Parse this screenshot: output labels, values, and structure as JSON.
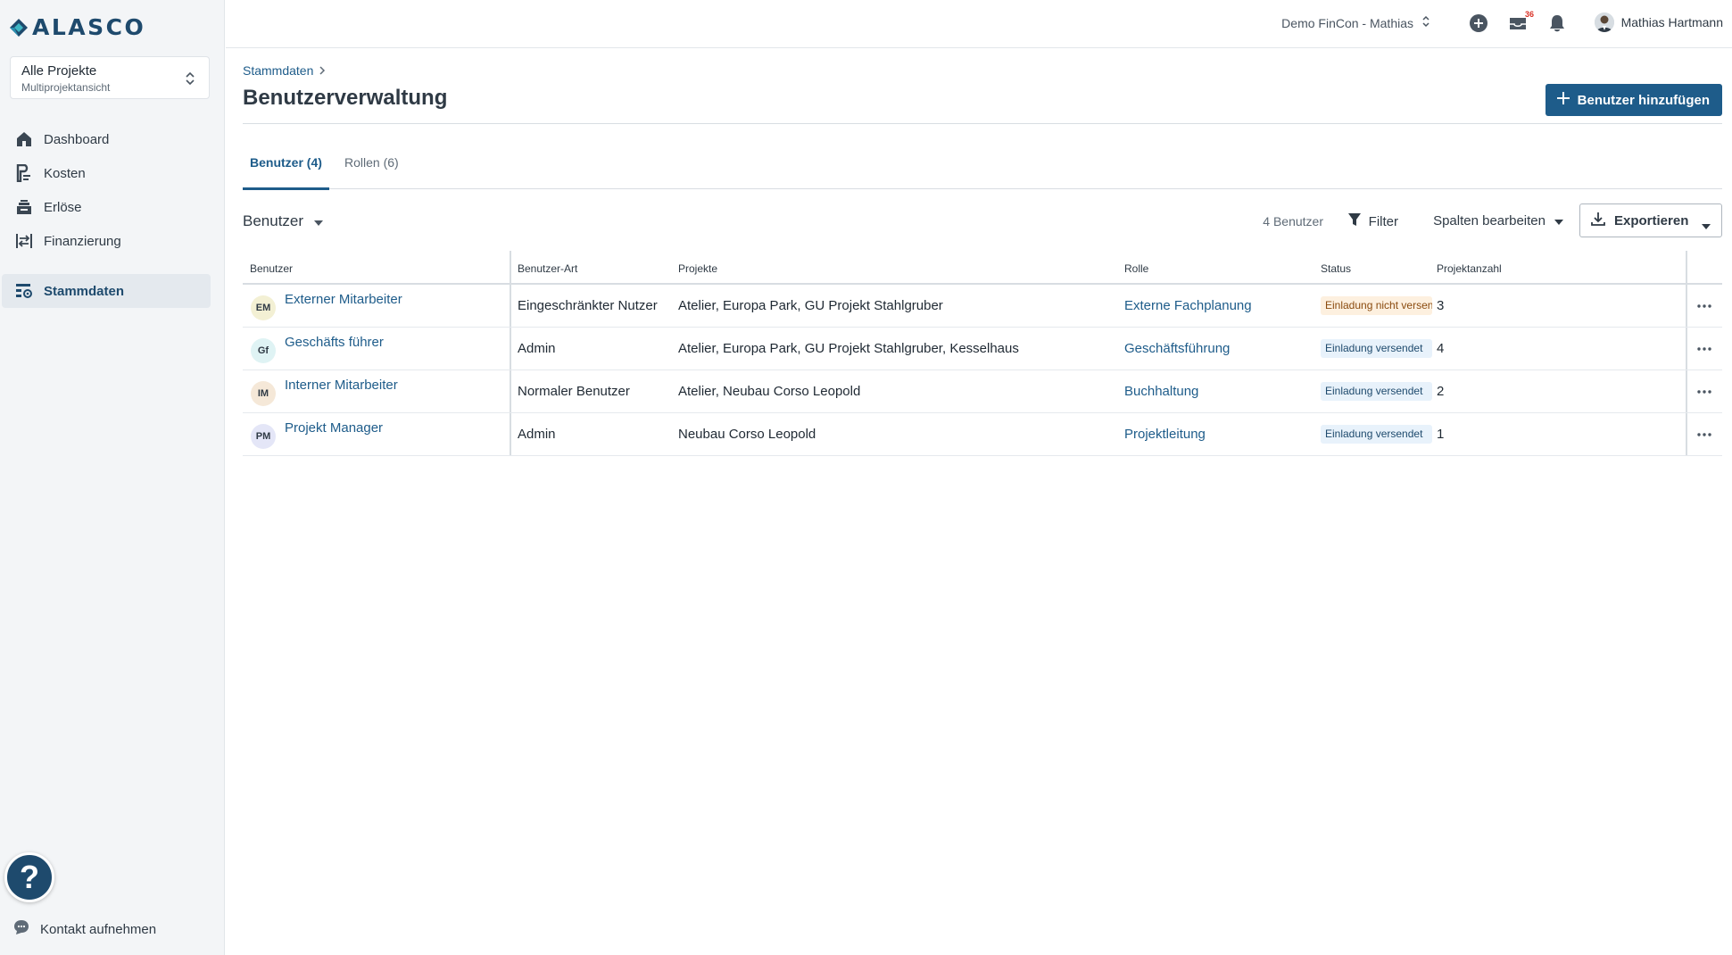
{
  "app": {
    "logo_text": "ALASCO",
    "project_selector": {
      "title": "Alle Projekte",
      "subtitle": "Multiprojektansicht"
    },
    "nav": [
      {
        "label": "Dashboard",
        "icon": "home-icon"
      },
      {
        "label": "Kosten",
        "icon": "costs-icon"
      },
      {
        "label": "Erlöse",
        "icon": "revenue-icon"
      },
      {
        "label": "Finanzierung",
        "icon": "financing-icon"
      },
      {
        "label": "Stammdaten",
        "icon": "master-data-icon",
        "active": true
      }
    ],
    "help_label": "?",
    "contact_label": "Kontakt aufnehmen"
  },
  "topbar": {
    "org": "Demo FinCon - Mathias",
    "inbox_badge": "36",
    "user_name": "Mathias Hartmann"
  },
  "page": {
    "breadcrumb": "Stammdaten",
    "title": "Benutzerverwaltung",
    "add_button": "Benutzer hinzufügen"
  },
  "tabs": [
    {
      "label": "Benutzer (4)",
      "active": true
    },
    {
      "label": "Rollen (6)",
      "active": false
    }
  ],
  "toolbar": {
    "view_label": "Benutzer",
    "count": "4 Benutzer",
    "filter": "Filter",
    "columns": "Spalten bearbeiten",
    "export": "Exportieren"
  },
  "table": {
    "headers": [
      "Benutzer",
      "Benutzer-Art",
      "Projekte",
      "Rolle",
      "Status",
      "Projektanzahl"
    ],
    "rows": [
      {
        "initials": "EM",
        "avatar_color": "#f3f0d4",
        "name": "Externer Mitarbeiter",
        "type": "Eingeschränkter Nutzer",
        "projects": "Atelier, Europa Park, GU Projekt Stahlgruber",
        "role": "Externe Fachplanung",
        "status": "Einladung nicht versendet",
        "status_kind": "warn",
        "count": "3"
      },
      {
        "initials": "Gf",
        "avatar_color": "#dff3f4",
        "name": "Geschäfts führer",
        "type": "Admin",
        "projects": "Atelier, Europa Park, GU Projekt Stahlgruber, Kesselhaus",
        "role": "Geschäftsführung",
        "status": "Einladung versendet",
        "status_kind": "info",
        "count": "4"
      },
      {
        "initials": "IM",
        "avatar_color": "#f5e8d8",
        "name": "Interner Mitarbeiter",
        "type": "Normaler Benutzer",
        "projects": "Atelier, Neubau Corso Leopold",
        "role": "Buchhaltung",
        "status": "Einladung versendet",
        "status_kind": "info",
        "count": "2"
      },
      {
        "initials": "PM",
        "avatar_color": "#e4e6f7",
        "name": "Projekt Manager",
        "type": "Admin",
        "projects": "Neubau Corso Leopold",
        "role": "Projektleitung",
        "status": "Einladung versendet",
        "status_kind": "info",
        "count": "1"
      }
    ]
  },
  "colors": {
    "brand": "#1e4a6d",
    "accent": "#1e5c8a",
    "sidebar_bg": "#f3f5f7"
  }
}
